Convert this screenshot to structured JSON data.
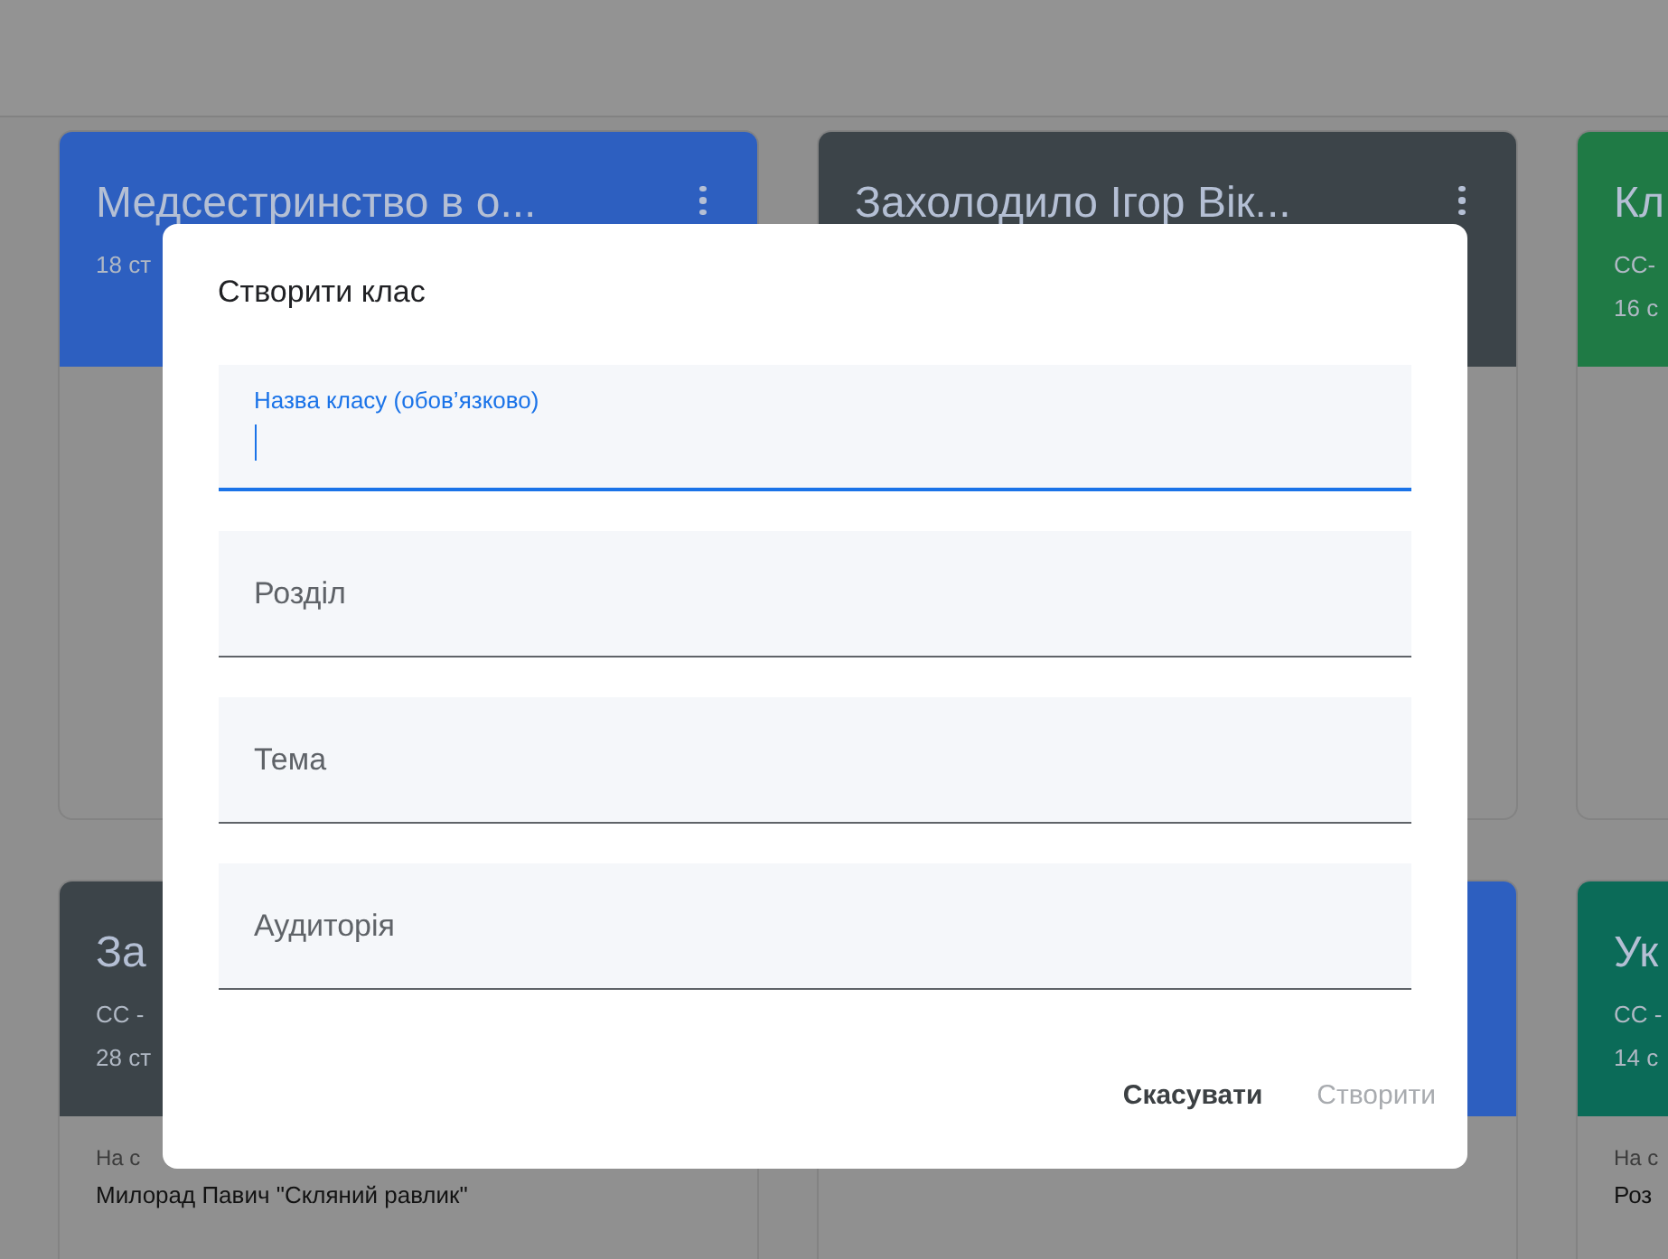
{
  "cards": [
    {
      "title": "Медсестринство в о...",
      "lines": [
        "18 ст"
      ],
      "color": "#2d5fc0",
      "menu": true
    },
    {
      "title": "Захолодило Ігор Вік...",
      "color": "#3c4449",
      "menu": true
    },
    {
      "title": "Кл",
      "lines": [
        "СС-",
        "16 с"
      ],
      "color": "#1f7a45",
      "menu": false
    },
    {
      "title": "За",
      "lines": [
        "СС -",
        "28 ст"
      ],
      "color": "#3c4449",
      "menu": false,
      "footer": [
        "На с",
        "Милорад Павич \"Скляний равлик\""
      ]
    },
    {
      "color": "#2d5fc0",
      "menu": false
    },
    {
      "title": "Ук",
      "lines": [
        "СС -",
        "14 с"
      ],
      "color": "#0b6b58",
      "menu": false,
      "footer": [
        "На с",
        "Роз"
      ]
    }
  ],
  "dialog": {
    "title": "Створити клас",
    "fields": [
      {
        "label": "Назва класу (обов’язково)",
        "focused": true
      },
      {
        "label": "Розділ",
        "focused": false
      },
      {
        "label": "Тема",
        "focused": false
      },
      {
        "label": "Аудиторія",
        "focused": false
      }
    ],
    "buttons": [
      {
        "label": "Скасувати",
        "disabled": false
      },
      {
        "label": "Створити",
        "disabled": true
      }
    ]
  }
}
